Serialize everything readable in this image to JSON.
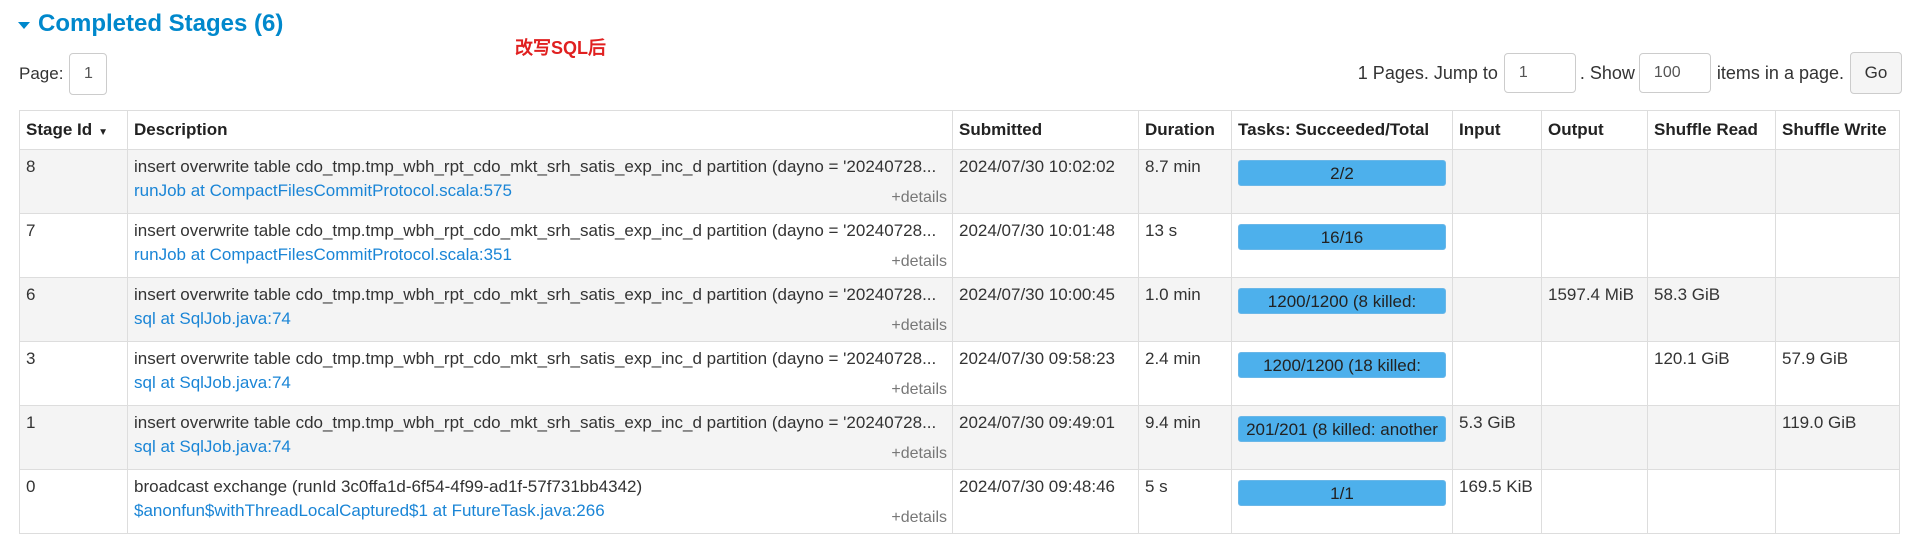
{
  "section": {
    "title": "Completed Stages (6)"
  },
  "note": "改写SQL后",
  "pagination": {
    "page_label": "Page:",
    "page_value": "1",
    "pages_text": "1 Pages. Jump to",
    "jump_value": "1",
    "show_label": ". Show",
    "show_value": "100",
    "items_label": "items in a page.",
    "go_label": "Go"
  },
  "table": {
    "headers": [
      "Stage Id",
      "Description",
      "Submitted",
      "Duration",
      "Tasks: Succeeded/Total",
      "Input",
      "Output",
      "Shuffle Read",
      "Shuffle Write"
    ],
    "rows": [
      {
        "stage_id": "8",
        "description": "insert overwrite table cdo_tmp.tmp_wbh_rpt_cdo_mkt_srh_satis_exp_inc_d partition (dayno = '20240728...",
        "link": "runJob at CompactFilesCommitProtocol.scala:575",
        "details": "+details",
        "submitted": "2024/07/30 10:02:02",
        "duration": "8.7 min",
        "tasks": "2/2",
        "input": "",
        "output": "",
        "shuffle_read": "",
        "shuffle_write": ""
      },
      {
        "stage_id": "7",
        "description": "insert overwrite table cdo_tmp.tmp_wbh_rpt_cdo_mkt_srh_satis_exp_inc_d partition (dayno = '20240728...",
        "link": "runJob at CompactFilesCommitProtocol.scala:351",
        "details": "+details",
        "submitted": "2024/07/30 10:01:48",
        "duration": "13 s",
        "tasks": "16/16",
        "input": "",
        "output": "",
        "shuffle_read": "",
        "shuffle_write": ""
      },
      {
        "stage_id": "6",
        "description": "insert overwrite table cdo_tmp.tmp_wbh_rpt_cdo_mkt_srh_satis_exp_inc_d partition (dayno = '20240728...",
        "link": "sql at SqlJob.java:74",
        "details": "+details",
        "submitted": "2024/07/30 10:00:45",
        "duration": "1.0 min",
        "tasks": "1200/1200 (8 killed:",
        "input": "",
        "output": "1597.4 MiB",
        "shuffle_read": "58.3 GiB",
        "shuffle_write": ""
      },
      {
        "stage_id": "3",
        "description": "insert overwrite table cdo_tmp.tmp_wbh_rpt_cdo_mkt_srh_satis_exp_inc_d partition (dayno = '20240728...",
        "link": "sql at SqlJob.java:74",
        "details": "+details",
        "submitted": "2024/07/30 09:58:23",
        "duration": "2.4 min",
        "tasks": "1200/1200 (18 killed:",
        "input": "",
        "output": "",
        "shuffle_read": "120.1 GiB",
        "shuffle_write": "57.9 GiB"
      },
      {
        "stage_id": "1",
        "description": "insert overwrite table cdo_tmp.tmp_wbh_rpt_cdo_mkt_srh_satis_exp_inc_d partition (dayno = '20240728...",
        "link": "sql at SqlJob.java:74",
        "details": "+details",
        "submitted": "2024/07/30 09:49:01",
        "duration": "9.4 min",
        "tasks": "201/201 (8 killed: another",
        "input": "5.3 GiB",
        "output": "",
        "shuffle_read": "",
        "shuffle_write": "119.0 GiB"
      },
      {
        "stage_id": "0",
        "description": "broadcast exchange (runId 3c0ffa1d-6f54-4f99-ad1f-57f731bb4342)",
        "link": "$anonfun$withThreadLocalCaptured$1 at FutureTask.java:266",
        "details": "+details",
        "submitted": "2024/07/30 09:48:46",
        "duration": "5 s",
        "tasks": "1/1",
        "input": "169.5 KiB",
        "output": "",
        "shuffle_read": "",
        "shuffle_write": ""
      }
    ]
  }
}
